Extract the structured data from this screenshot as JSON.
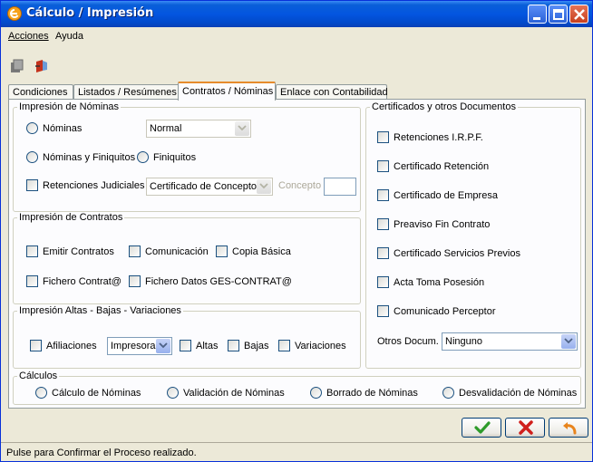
{
  "window": {
    "title": "Cálculo / Impresión"
  },
  "menu": [
    {
      "label": "Acciones"
    },
    {
      "label": "Ayuda"
    }
  ],
  "tabs": [
    {
      "label": "Condiciones"
    },
    {
      "label": "Listados / Resúmenes"
    },
    {
      "label": "Contratos / Nóminas",
      "active": true
    },
    {
      "label": "Enlace con Contabilidad"
    }
  ],
  "impresion_nominas": {
    "title": "Impresión de Nóminas",
    "nominas_label": "Nóminas",
    "nominas_combo": "Normal",
    "nominas_finiquitos_label": "Nóminas y Finiquitos",
    "finiquitos_label": "Finiquitos",
    "retenciones_judiciales_label": "Retenciones Judiciales",
    "retenciones_combo": "Certificado de Concepto",
    "concepto_label": "Concepto",
    "concepto_value": ""
  },
  "impresion_contratos": {
    "title": "Impresión de Contratos",
    "emitir_contratos": "Emitir Contratos",
    "comunicacion": "Comunicación",
    "copia_basica": "Copia Básica",
    "fichero_contrat": "Fichero Contrat@",
    "fichero_datos": "Fichero Datos GES-CONTRAT@"
  },
  "impresion_altas": {
    "title": "Impresión Altas - Bajas - Variaciones",
    "afiliaciones": "Afiliaciones",
    "impresora_combo": "Impresora",
    "altas": "Altas",
    "bajas": "Bajas",
    "variaciones": "Variaciones"
  },
  "certificados": {
    "title": "Certificados y otros Documentos",
    "items": [
      "Retenciones I.R.P.F.",
      "Certificado Retención",
      "Certificado de Empresa",
      "Preaviso Fin Contrato",
      "Certificado Servicios Previos",
      "Acta Toma Posesión",
      "Comunicado Perceptor"
    ],
    "otros_label": "Otros Docum.",
    "otros_combo": "Ninguno"
  },
  "calculos": {
    "title": "Cálculos",
    "options": [
      "Cálculo de Nóminas",
      "Validación de Nóminas",
      "Borrado de Nóminas",
      "Desvalidación de Nóminas"
    ]
  },
  "status": "Pulse para Confirmar el Proceso realizado."
}
